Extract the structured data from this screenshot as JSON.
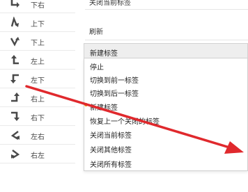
{
  "gestures": [
    {
      "label": "下右",
      "icon": "down-right-gesture-icon"
    },
    {
      "label": "上下",
      "icon": "up-down-gesture-icon"
    },
    {
      "label": "下上",
      "icon": "down-up-gesture-icon"
    },
    {
      "label": "左上",
      "icon": "left-up-gesture-icon"
    },
    {
      "label": "左下",
      "icon": "left-down-gesture-icon"
    },
    {
      "label": "右上",
      "icon": "right-up-gesture-icon"
    },
    {
      "label": "右下",
      "icon": "right-down-gesture-icon"
    },
    {
      "label": "左右",
      "icon": "left-right-gesture-icon"
    },
    {
      "label": "右左",
      "icon": "right-left-gesture-icon"
    }
  ],
  "actions": {
    "row0": "关闭当前标签",
    "row1": "刷新"
  },
  "dropdown": {
    "selected": "新建标签",
    "options": [
      "停止",
      "切换到前一标签",
      "切换到后一标签",
      "新建标签",
      "恢复上一个关闭的标签",
      "关闭当前标签",
      "关闭其他标签",
      "关闭所有标签"
    ],
    "current_index": 3
  },
  "colors": {
    "icon": "#4a4a4a",
    "marker": "#f08a00",
    "arrow": "#e0292d",
    "dropdown_bg": "#eeeeee"
  }
}
